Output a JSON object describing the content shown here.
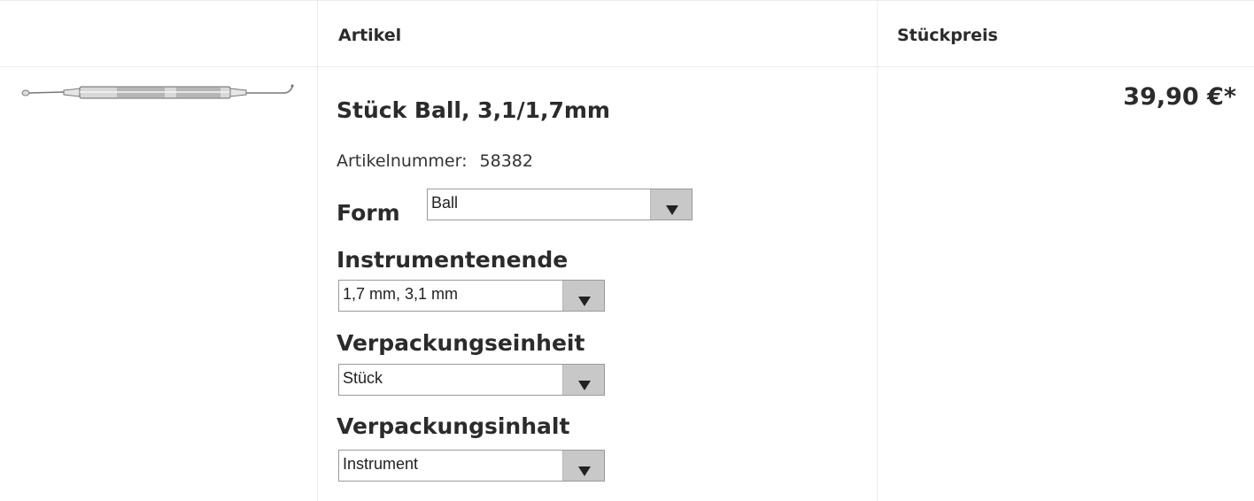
{
  "table": {
    "col_article": "Artikel",
    "col_unit_price": "Stückpreis"
  },
  "product": {
    "image_alt": "dental instrument",
    "title": "Stück Ball, 3,1/1,7mm",
    "article_number_label": "Artikelnummer:",
    "article_number": "58382",
    "price": "39,90 €*"
  },
  "options": {
    "form": {
      "label": "Form",
      "value": "Ball"
    },
    "instrument_end": {
      "label": "Instrumentenende",
      "value": "1,7 mm, 3,1 mm"
    },
    "packaging_unit": {
      "label": "Verpackungseinheit",
      "value": "Stück"
    },
    "packaging_content": {
      "label": "Verpackungsinhalt",
      "value": "Instrument"
    }
  }
}
